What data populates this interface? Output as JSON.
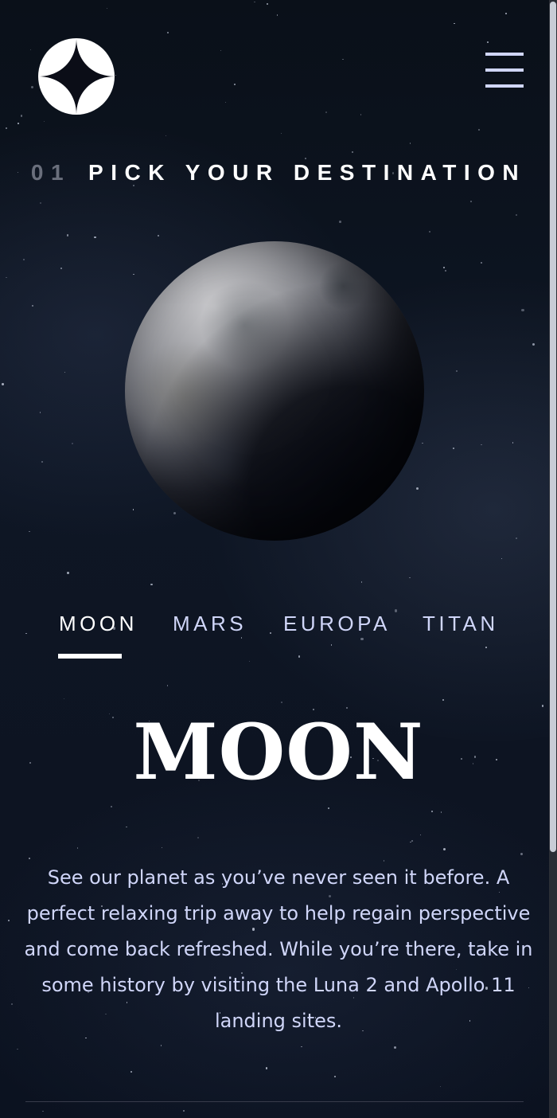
{
  "header": {
    "logo_icon": "star-logo-icon",
    "menu_icon": "hamburger-menu-icon"
  },
  "page_heading": {
    "number": "01",
    "text": "PICK YOUR DESTINATION"
  },
  "destination_image": "moon-planet-image",
  "tabs": [
    {
      "label": "MOON",
      "active": true
    },
    {
      "label": "MARS",
      "active": false
    },
    {
      "label": "EUROPA",
      "active": false
    },
    {
      "label": "TITAN",
      "active": false
    }
  ],
  "destination": {
    "name": "MOON",
    "description": "See our planet as you’ve never seen it before. A perfect relaxing trip away to help regain perspective and come back refreshed. While you’re there, take in some history by visiting the Luna 2 and Apollo 11 landing sites."
  },
  "colors": {
    "background": "#0b0d17",
    "accent_light": "#d0d6f9",
    "white": "#ffffff",
    "muted_number": "#6a6f7c"
  }
}
